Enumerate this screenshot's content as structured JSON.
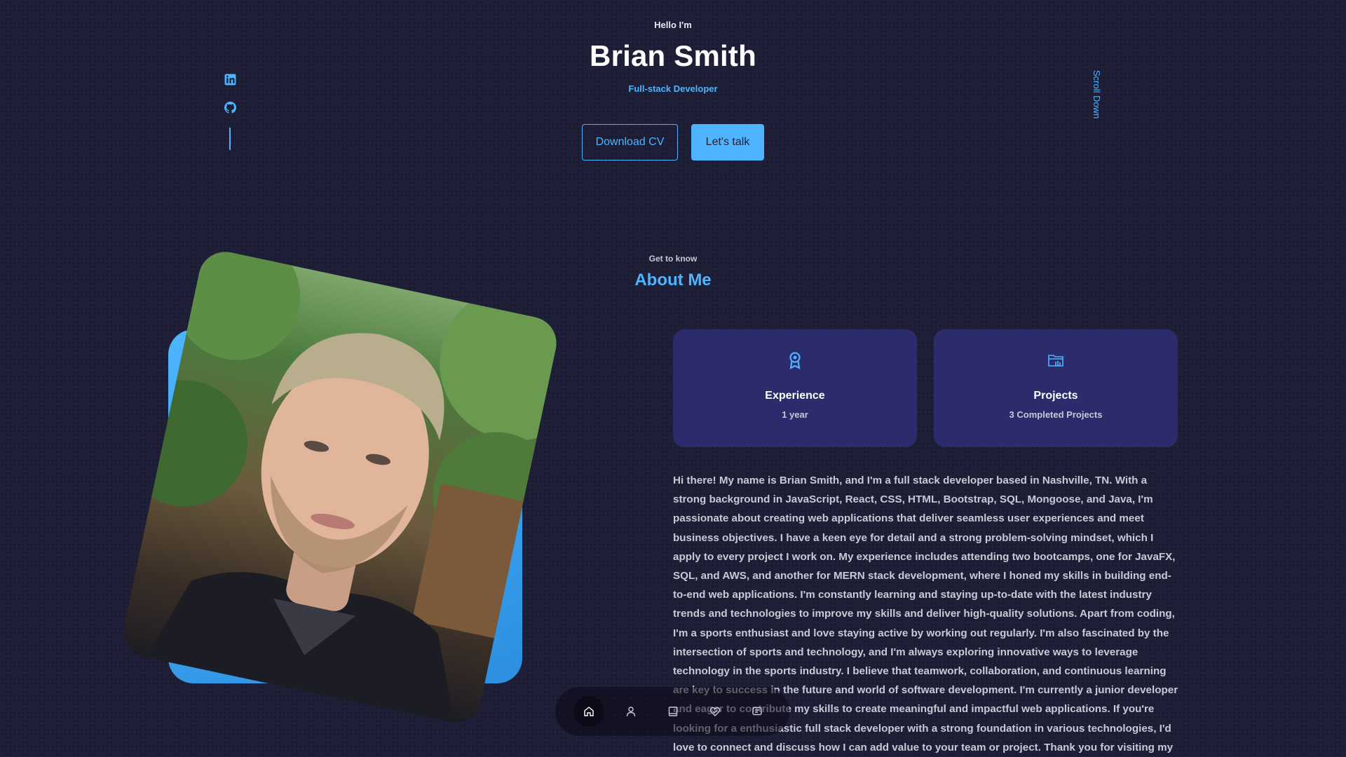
{
  "header": {
    "greeting": "Hello I'm",
    "name": "Brian Smith",
    "role": "Full-stack Developer",
    "download_cv_label": "Download CV",
    "lets_talk_label": "Let's talk",
    "scroll_down_label": "Scroll Down"
  },
  "socials": [
    {
      "icon": "linkedin-icon"
    },
    {
      "icon": "github-icon"
    }
  ],
  "about": {
    "eyebrow": "Get to know",
    "title": "About Me",
    "cards": [
      {
        "icon": "award-icon",
        "title": "Experience",
        "subtitle": "1 year"
      },
      {
        "icon": "folder-icon",
        "title": "Projects",
        "subtitle": "3 Completed Projects"
      }
    ],
    "bio": "Hi there! My name is Brian Smith, and I'm a full stack developer based in Nashville, TN. With a strong background in JavaScript, React, CSS, HTML, Bootstrap, SQL, Mongoose, and Java, I'm passionate about creating web applications that deliver seamless user experiences and meet business objectives. I have a keen eye for detail and a strong problem-solving mindset, which I apply to every project I work on. My experience includes attending two bootcamps, one for JavaFX, SQL, and AWS, and another for MERN stack development, where I honed my skills in building end-to-end web applications. I'm constantly learning and staying up-to-date with the latest industry trends and technologies to improve my skills and deliver high-quality solutions. Apart from coding, I'm a sports enthusiast and love staying active by working out regularly. I'm also fascinated by the intersection of sports and technology, and I'm always exploring innovative ways to leverage technology in the sports industry. I believe that teamwork, collaboration, and continuous learning are key to success in the future and world of software development. I'm currently a junior developer and eager to contribute my skills to create meaningful and impactful web applications. If you're looking for a enthusiastic full stack developer with a strong foundation in various technologies, I'd love to connect and discuss how I can add value to your team or project. Thank you for visiting my"
  },
  "nav": [
    {
      "icon": "home-icon",
      "active": true
    },
    {
      "icon": "user-icon",
      "active": false
    },
    {
      "icon": "book-icon",
      "active": false
    },
    {
      "icon": "services-icon",
      "active": false
    },
    {
      "icon": "message-icon",
      "active": false
    }
  ],
  "colors": {
    "background": "#1f1f38",
    "accent": "#4db5ff",
    "card": "#2c2c6c",
    "text_muted": "#c9c9d6"
  }
}
